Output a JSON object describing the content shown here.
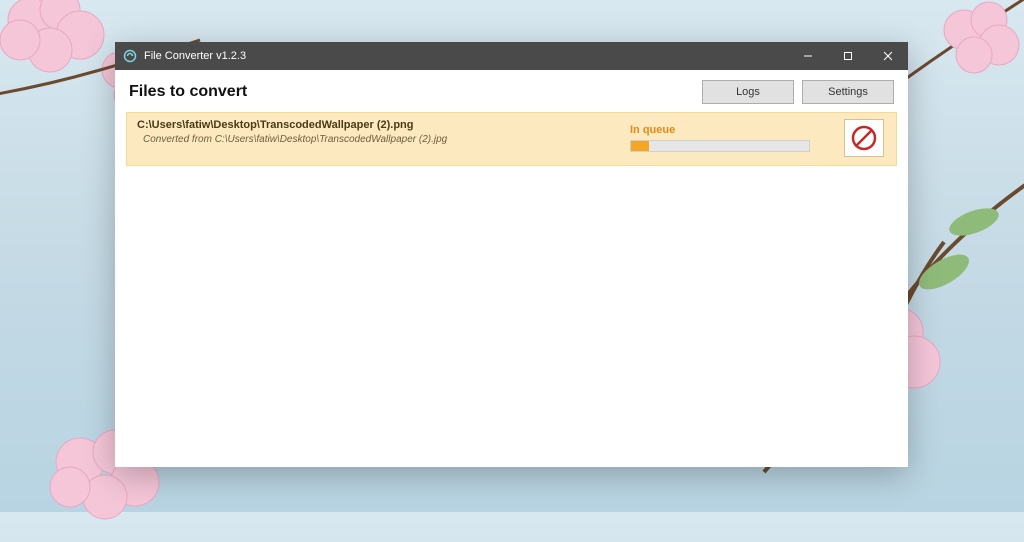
{
  "window": {
    "title": "File Converter v1.2.3"
  },
  "toolbar": {
    "heading": "Files to convert",
    "logs_label": "Logs",
    "settings_label": "Settings"
  },
  "item": {
    "output_path": "C:\\Users\\fatiw\\Desktop\\TranscodedWallpaper (2).png",
    "converted_from_prefix": "Converted from ",
    "source_path": "C:\\Users\\fatiw\\Desktop\\TranscodedWallpaper (2).jpg",
    "status": "In queue",
    "progress_percent": 10
  }
}
